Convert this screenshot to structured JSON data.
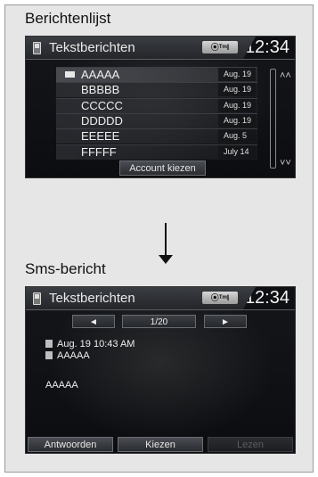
{
  "list_section": {
    "heading": "Berichtenlijst",
    "screen": {
      "title": "Tekstberichten",
      "status_badge": "⦿ᵀᵐl",
      "clock": "12:34",
      "messages": [
        {
          "name": "AAAAA",
          "date": "Aug. 19",
          "unread": true
        },
        {
          "name": "BBBBB",
          "date": "Aug. 19",
          "unread": false
        },
        {
          "name": "CCCCC",
          "date": "Aug. 19",
          "unread": false
        },
        {
          "name": "DDDDD",
          "date": "Aug. 19",
          "unread": false
        },
        {
          "name": "EEEEE",
          "date": "Aug.  5",
          "unread": false
        },
        {
          "name": "FFFFF",
          "date": "July 14",
          "unread": false
        }
      ],
      "scroll_up_icon": "double-chevron-up-icon",
      "scroll_down_icon": "double-chevron-down-icon",
      "account_button": "Account kiezen"
    }
  },
  "sms_section": {
    "heading": "Sms-bericht",
    "screen": {
      "title": "Tekstberichten",
      "status_badge": "⦿ᵀᵐl",
      "clock": "12:34",
      "prev_glyph": "◄",
      "next_glyph": "►",
      "page_indicator": "1/20",
      "timestamp": "Aug. 19 10:43 AM",
      "sender": "AAAAA",
      "body": "AAAAA",
      "buttons": {
        "reply": "Antwoorden",
        "select": "Kiezen",
        "read": "Lezen"
      }
    }
  }
}
